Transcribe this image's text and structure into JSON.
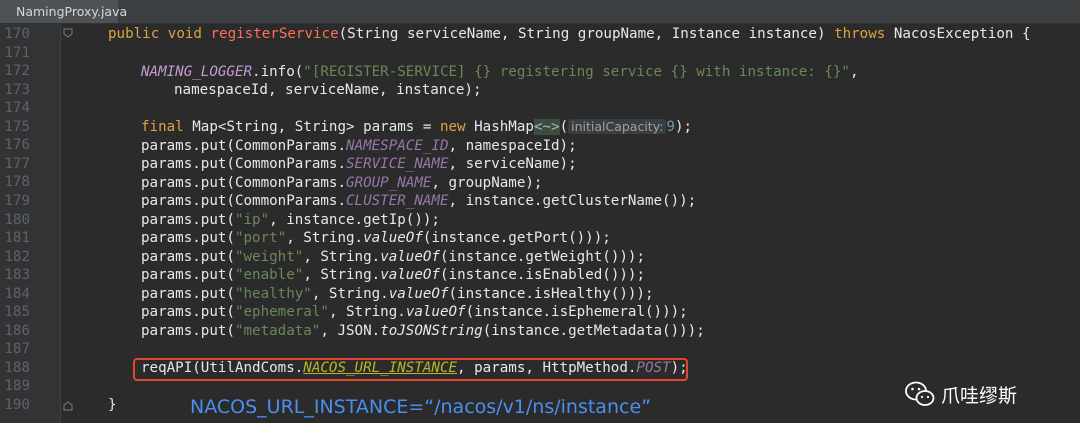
{
  "tab": {
    "label": "NamingProxy.java",
    "icon": "java-class-icon"
  },
  "line_numbers": [
    "170",
    "171",
    "172",
    "173",
    "174",
    "175",
    "176",
    "177",
    "178",
    "179",
    "180",
    "181",
    "182",
    "183",
    "184",
    "185",
    "186",
    "187",
    "188",
    "189",
    "190"
  ],
  "code": {
    "l170": {
      "kw1": "public",
      "kw2": "void",
      "method": "registerService",
      "params": "(String serviceName, String groupName, Instance instance) ",
      "throws": "throws",
      "exc": " NacosException {"
    },
    "l172": {
      "logger": "NAMING_LOGGER",
      "call": ".info(",
      "str": "\"[REGISTER-SERVICE] {} registering service {} with instance: {}\"",
      "end": ","
    },
    "l173": {
      "text": "namespaceId, serviceName, instance);"
    },
    "l175": {
      "final": "final",
      "type": " Map<String, String> params = ",
      "new": "new",
      "ctor": " HashMap",
      "diamond": "<~>",
      "open": "(",
      "hint": "initialCapacity:",
      "num": "9",
      "close": ");"
    },
    "l176": {
      "pre": "params.put(CommonParams.",
      "const": "NAMESPACE_ID",
      "post": ", namespaceId);"
    },
    "l177": {
      "pre": "params.put(CommonParams.",
      "const": "SERVICE_NAME",
      "post": ", serviceName);"
    },
    "l178": {
      "pre": "params.put(CommonParams.",
      "const": "GROUP_NAME",
      "post": ", groupName);"
    },
    "l179": {
      "pre": "params.put(CommonParams.",
      "const": "CLUSTER_NAME",
      "post": ", instance.getClusterName());"
    },
    "l180": {
      "pre": "params.put(",
      "str": "\"ip\"",
      "post": ", instance.getIp());"
    },
    "l181": {
      "pre": "params.put(",
      "str": "\"port\"",
      "mid": ", String.",
      "static": "valueOf",
      "post": "(instance.getPort()));"
    },
    "l182": {
      "pre": "params.put(",
      "str": "\"weight\"",
      "mid": ", String.",
      "static": "valueOf",
      "post": "(instance.getWeight()));"
    },
    "l183": {
      "pre": "params.put(",
      "str": "\"enable\"",
      "mid": ", String.",
      "static": "valueOf",
      "post": "(instance.isEnabled()));"
    },
    "l184": {
      "pre": "params.put(",
      "str": "\"healthy\"",
      "mid": ", String.",
      "static": "valueOf",
      "post": "(instance.isHealthy()));"
    },
    "l185": {
      "pre": "params.put(",
      "str": "\"ephemeral\"",
      "mid": ", String.",
      "static": "valueOf",
      "post": "(instance.isEphemeral()));"
    },
    "l186": {
      "pre": "params.put(",
      "str": "\"metadata\"",
      "mid": ", JSON.",
      "static": "toJSONString",
      "post": "(instance.getMetadata()));"
    },
    "l188": {
      "pre": "reqAPI(UtilAndComs.",
      "const": "NACOS_URL_INSTANCE",
      "mid": ", params, HttpMethod.",
      "const2": "POST",
      "post": ");"
    },
    "l190": {
      "text": "}"
    }
  },
  "annotation": "NACOS_URL_INSTANCE=“/nacos/v1/ns/instance”",
  "watermark": {
    "text": "爪哇缪斯",
    "icon": "wechat-icon"
  }
}
